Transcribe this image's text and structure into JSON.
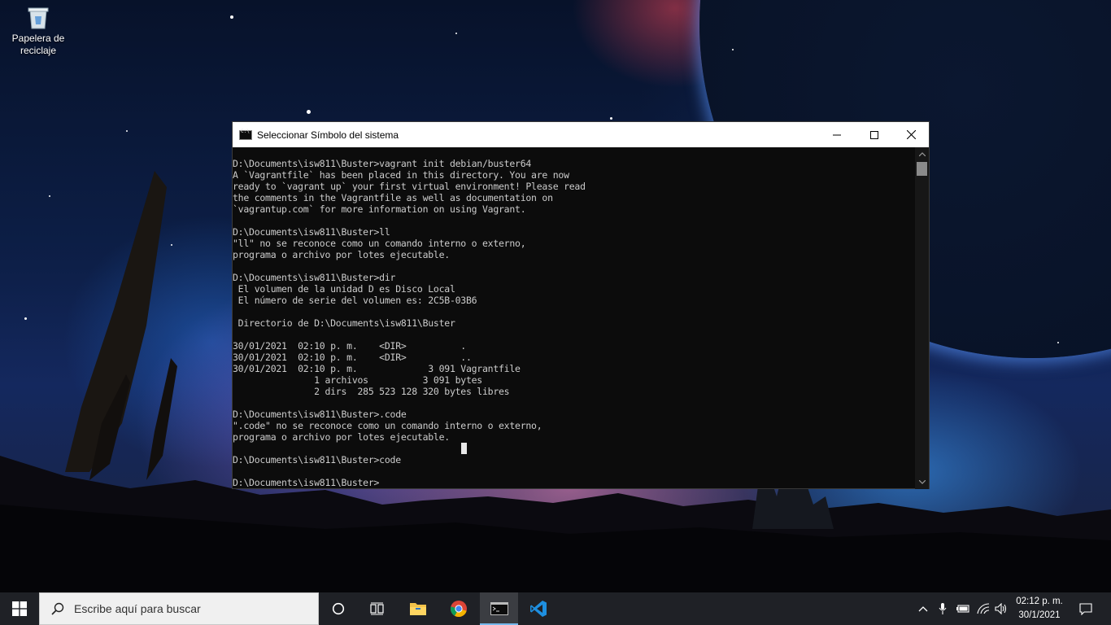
{
  "desktop": {
    "icons": [
      {
        "label_line1": "Papelera de",
        "label_line2": "reciclaje",
        "icon": "recycle-bin-icon"
      }
    ]
  },
  "cmd_window": {
    "title": "Seleccionar Símbolo del sistema",
    "icon": "cmd-icon",
    "controls": {
      "minimize": "minimize-icon",
      "maximize": "maximize-icon",
      "close": "close-icon"
    },
    "lines": [
      "D:\\Documents\\isw811\\Buster>vagrant init debian/buster64",
      "A `Vagrantfile` has been placed in this directory. You are now",
      "ready to `vagrant up` your first virtual environment! Please read",
      "the comments in the Vagrantfile as well as documentation on",
      "`vagrantup.com` for more information on using Vagrant.",
      "",
      "D:\\Documents\\isw811\\Buster>ll",
      "\"ll\" no se reconoce como un comando interno o externo,",
      "programa o archivo por lotes ejecutable.",
      "",
      "D:\\Documents\\isw811\\Buster>dir",
      " El volumen de la unidad D es Disco Local",
      " El número de serie del volumen es: 2C5B-03B6",
      "",
      " Directorio de D:\\Documents\\isw811\\Buster",
      "",
      "30/01/2021  02:10 p. m.    <DIR>          .",
      "30/01/2021  02:10 p. m.    <DIR>          ..",
      "30/01/2021  02:10 p. m.             3 091 Vagrantfile",
      "               1 archivos          3 091 bytes",
      "               2 dirs  285 523 128 320 bytes libres",
      "",
      "D:\\Documents\\isw811\\Buster>.code",
      "\".code\" no se reconoce como un comando interno o externo,",
      "programa o archivo por lotes ejecutable.",
      "",
      "D:\\Documents\\isw811\\Buster>code",
      "",
      "D:\\Documents\\isw811\\Buster>"
    ]
  },
  "taskbar": {
    "start_icon": "windows-start-icon",
    "search_placeholder": "Escribe aquí para buscar",
    "search_icon": "search-icon",
    "pinned": [
      {
        "name": "cortana-icon"
      },
      {
        "name": "task-view-icon"
      },
      {
        "name": "file-explorer-icon"
      },
      {
        "name": "chrome-icon"
      },
      {
        "name": "command-prompt-icon",
        "active": true
      },
      {
        "name": "vscode-icon"
      }
    ],
    "tray": {
      "icons": [
        "chevron-up-icon",
        "microphone-icon",
        "battery-icon",
        "wifi-icon",
        "volume-icon"
      ],
      "time": "02:12 p. m.",
      "date": "30/1/2021",
      "notification_icon": "notification-icon"
    }
  }
}
